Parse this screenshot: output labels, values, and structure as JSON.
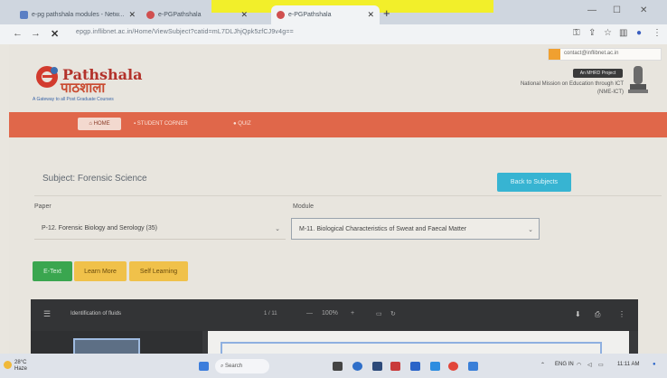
{
  "browser": {
    "tabs": [
      {
        "label": "e-pg pathshala modules - Netw..."
      },
      {
        "label": "e-PGPathshala"
      },
      {
        "label": "e-PGPathshala"
      }
    ],
    "address": "epgp.inflibnet.ac.in/Home/ViewSubject?catid=mL7DLJhjQpk5zfCJ9v4g=="
  },
  "page": {
    "email": "contact@inflibnet.ac.in",
    "logo_text": "Pathshala",
    "logo_hindi": "पाठशाला",
    "tagline": "A Gateway to all Post Graduate Courses",
    "project_badge": "An MHRD Project",
    "ministry_line1": "National Mission on Education through ICT",
    "ministry_line2": "(NME-ICT)",
    "nav": {
      "home": "HOME",
      "student_corner": "STUDENT CORNER",
      "quiz": "QUIZ"
    },
    "subject_label": "Subject: Forensic Science",
    "back_button": "Back to Subjects",
    "paper_label": "Paper",
    "module_label": "Module",
    "paper_value": "P-12. Forensic Biology and Serology (35)",
    "module_value": "M-11. Biological Characteristics of Sweat and Faecal Matter",
    "buttons": {
      "etext": "E-Text",
      "learn_more": "Learn More",
      "self_learning": "Self Learning"
    },
    "viewer": {
      "title": "Identification of fluids",
      "page": "1 / 11",
      "zoom": "100%"
    }
  },
  "taskbar": {
    "weather_temp": "28°C",
    "weather_desc": "Haze",
    "search": "Search",
    "lang": "ENG\nIN",
    "time": "11:11 AM"
  }
}
